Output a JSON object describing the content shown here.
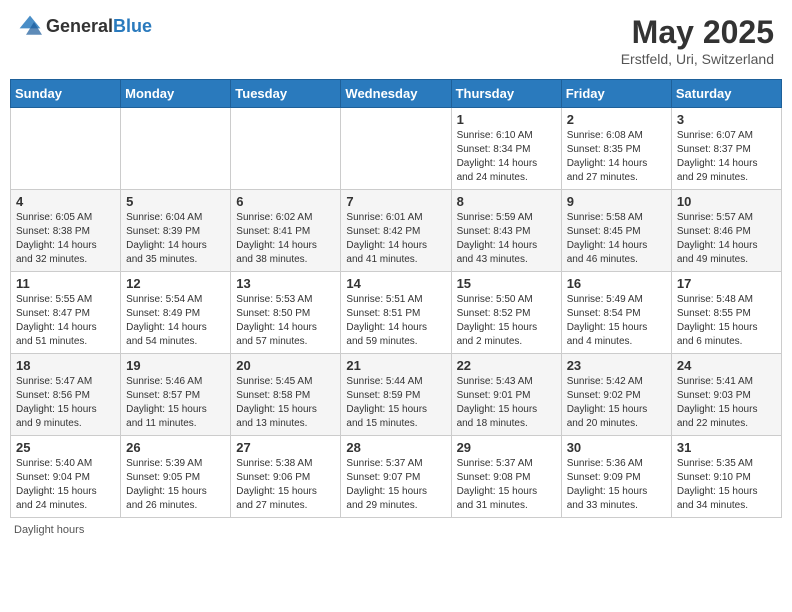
{
  "logo": {
    "general": "General",
    "blue": "Blue"
  },
  "header": {
    "title": "May 2025",
    "subtitle": "Erstfeld, Uri, Switzerland"
  },
  "weekdays": [
    "Sunday",
    "Monday",
    "Tuesday",
    "Wednesday",
    "Thursday",
    "Friday",
    "Saturday"
  ],
  "weeks": [
    [
      {
        "day": "",
        "info": ""
      },
      {
        "day": "",
        "info": ""
      },
      {
        "day": "",
        "info": ""
      },
      {
        "day": "",
        "info": ""
      },
      {
        "day": "1",
        "info": "Sunrise: 6:10 AM\nSunset: 8:34 PM\nDaylight: 14 hours\nand 24 minutes."
      },
      {
        "day": "2",
        "info": "Sunrise: 6:08 AM\nSunset: 8:35 PM\nDaylight: 14 hours\nand 27 minutes."
      },
      {
        "day": "3",
        "info": "Sunrise: 6:07 AM\nSunset: 8:37 PM\nDaylight: 14 hours\nand 29 minutes."
      }
    ],
    [
      {
        "day": "4",
        "info": "Sunrise: 6:05 AM\nSunset: 8:38 PM\nDaylight: 14 hours\nand 32 minutes."
      },
      {
        "day": "5",
        "info": "Sunrise: 6:04 AM\nSunset: 8:39 PM\nDaylight: 14 hours\nand 35 minutes."
      },
      {
        "day": "6",
        "info": "Sunrise: 6:02 AM\nSunset: 8:41 PM\nDaylight: 14 hours\nand 38 minutes."
      },
      {
        "day": "7",
        "info": "Sunrise: 6:01 AM\nSunset: 8:42 PM\nDaylight: 14 hours\nand 41 minutes."
      },
      {
        "day": "8",
        "info": "Sunrise: 5:59 AM\nSunset: 8:43 PM\nDaylight: 14 hours\nand 43 minutes."
      },
      {
        "day": "9",
        "info": "Sunrise: 5:58 AM\nSunset: 8:45 PM\nDaylight: 14 hours\nand 46 minutes."
      },
      {
        "day": "10",
        "info": "Sunrise: 5:57 AM\nSunset: 8:46 PM\nDaylight: 14 hours\nand 49 minutes."
      }
    ],
    [
      {
        "day": "11",
        "info": "Sunrise: 5:55 AM\nSunset: 8:47 PM\nDaylight: 14 hours\nand 51 minutes."
      },
      {
        "day": "12",
        "info": "Sunrise: 5:54 AM\nSunset: 8:49 PM\nDaylight: 14 hours\nand 54 minutes."
      },
      {
        "day": "13",
        "info": "Sunrise: 5:53 AM\nSunset: 8:50 PM\nDaylight: 14 hours\nand 57 minutes."
      },
      {
        "day": "14",
        "info": "Sunrise: 5:51 AM\nSunset: 8:51 PM\nDaylight: 14 hours\nand 59 minutes."
      },
      {
        "day": "15",
        "info": "Sunrise: 5:50 AM\nSunset: 8:52 PM\nDaylight: 15 hours\nand 2 minutes."
      },
      {
        "day": "16",
        "info": "Sunrise: 5:49 AM\nSunset: 8:54 PM\nDaylight: 15 hours\nand 4 minutes."
      },
      {
        "day": "17",
        "info": "Sunrise: 5:48 AM\nSunset: 8:55 PM\nDaylight: 15 hours\nand 6 minutes."
      }
    ],
    [
      {
        "day": "18",
        "info": "Sunrise: 5:47 AM\nSunset: 8:56 PM\nDaylight: 15 hours\nand 9 minutes."
      },
      {
        "day": "19",
        "info": "Sunrise: 5:46 AM\nSunset: 8:57 PM\nDaylight: 15 hours\nand 11 minutes."
      },
      {
        "day": "20",
        "info": "Sunrise: 5:45 AM\nSunset: 8:58 PM\nDaylight: 15 hours\nand 13 minutes."
      },
      {
        "day": "21",
        "info": "Sunrise: 5:44 AM\nSunset: 8:59 PM\nDaylight: 15 hours\nand 15 minutes."
      },
      {
        "day": "22",
        "info": "Sunrise: 5:43 AM\nSunset: 9:01 PM\nDaylight: 15 hours\nand 18 minutes."
      },
      {
        "day": "23",
        "info": "Sunrise: 5:42 AM\nSunset: 9:02 PM\nDaylight: 15 hours\nand 20 minutes."
      },
      {
        "day": "24",
        "info": "Sunrise: 5:41 AM\nSunset: 9:03 PM\nDaylight: 15 hours\nand 22 minutes."
      }
    ],
    [
      {
        "day": "25",
        "info": "Sunrise: 5:40 AM\nSunset: 9:04 PM\nDaylight: 15 hours\nand 24 minutes."
      },
      {
        "day": "26",
        "info": "Sunrise: 5:39 AM\nSunset: 9:05 PM\nDaylight: 15 hours\nand 26 minutes."
      },
      {
        "day": "27",
        "info": "Sunrise: 5:38 AM\nSunset: 9:06 PM\nDaylight: 15 hours\nand 27 minutes."
      },
      {
        "day": "28",
        "info": "Sunrise: 5:37 AM\nSunset: 9:07 PM\nDaylight: 15 hours\nand 29 minutes."
      },
      {
        "day": "29",
        "info": "Sunrise: 5:37 AM\nSunset: 9:08 PM\nDaylight: 15 hours\nand 31 minutes."
      },
      {
        "day": "30",
        "info": "Sunrise: 5:36 AM\nSunset: 9:09 PM\nDaylight: 15 hours\nand 33 minutes."
      },
      {
        "day": "31",
        "info": "Sunrise: 5:35 AM\nSunset: 9:10 PM\nDaylight: 15 hours\nand 34 minutes."
      }
    ]
  ],
  "footer": {
    "daylight_label": "Daylight hours"
  }
}
